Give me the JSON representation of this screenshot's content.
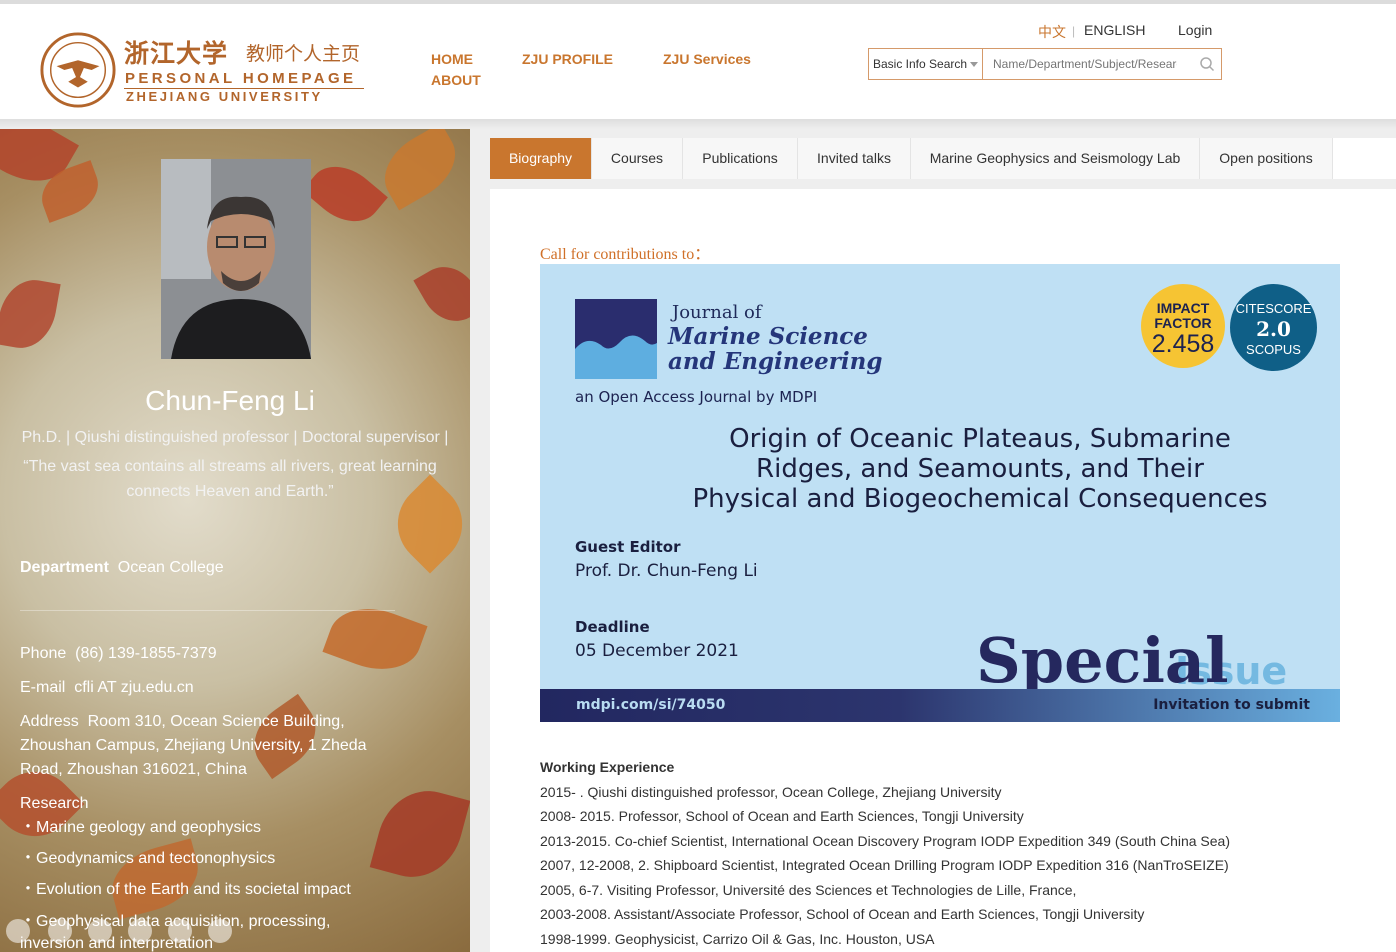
{
  "header": {
    "logo_cn": "浙江大学",
    "logo_cn2": "教师个人主页",
    "logo_en1": "PERSONAL HOMEPAGE",
    "logo_en2": "ZHEJIANG UNIVERSITY",
    "nav": [
      "HOME",
      "ZJU PROFILE",
      "ZJU Services",
      "ABOUT"
    ],
    "lang_cn": "中文",
    "lang_sep": "|",
    "lang_en": "ENGLISH",
    "login": "Login",
    "search_type": "Basic Info Search",
    "search_placeholder": "Name/Department/Subject/Research"
  },
  "profile": {
    "name": "Chun-Feng Li",
    "titles": "Ph.D.  |  Qiushi distinguished professor  |  Doctoral supervisor  |",
    "quote": "“The vast sea contains all streams all rivers, great learning connects Heaven and Earth.”",
    "department_label": "Department",
    "department": "Ocean College",
    "phone_label": "Phone",
    "phone": "(86) 139-1855-7379",
    "email_label": "E-mail",
    "email": "cfli AT zju.edu.cn",
    "address_label": "Address",
    "address": "Room 310, Ocean Science Building, Zhoushan Campus, Zhejiang University, 1 Zheda Road, Zhoushan 316021, China",
    "research_label": "Research",
    "research": [
      "・Marine geology and geophysics",
      "・Geodynamics and tectonophysics",
      "・Evolution of the Earth and its societal impact",
      "・Geophysical data acquisition, processing, inversion and interpretation"
    ]
  },
  "tabs": [
    "Biography",
    "Courses",
    "Publications",
    "Invited talks",
    "Marine Geophysics and Seismology Lab",
    "Open positions"
  ],
  "call": "Call for contributions to：",
  "banner": {
    "journal_of": "Journal of",
    "journal_name1": "Marine Science",
    "journal_name2": "and Engineering",
    "open_access": "an Open Access Journal by MDPI",
    "if_label1": "IMPACT",
    "if_label2": "FACTOR",
    "if_value": "2.458",
    "cs_label": "CITESCORE",
    "cs_value": "2.0",
    "cs_source": "SCOPUS",
    "headline1": "Origin of Oceanic Plateaus, Submarine",
    "headline2": "Ridges, and Seamounts, and Their",
    "headline3": "Physical and Biogeochemical Consequences",
    "guest_label": "Guest Editor",
    "guest": "Prof. Dr. Chun-Feng Li",
    "deadline_label": "Deadline",
    "deadline": "05 December 2021",
    "special": "Special",
    "issue": "Issue",
    "url": "mdpi.com/si/74050",
    "submit": "Invitation to submit"
  },
  "experience": {
    "heading": "Working Experience",
    "items": [
      "2015- . Qiushi distinguished professor,  Ocean College, Zhejiang University",
      "2008- 2015. Professor, School of Ocean and Earth Sciences, Tongji University",
      "2013-2015. Co-chief Scientist, International Ocean Discovery Program IODP Expedition 349 (South China Sea)",
      "2007, 12-2008, 2. Shipboard Scientist, Integrated Ocean Drilling Program IODP Expedition 316 (NanTroSEIZE)",
      "2005, 6-7. Visiting Professor, Université des Sciences et Technologies de Lille, France,",
      "2003-2008. Assistant/Associate Professor, School of Ocean and Earth Sciences, Tongji University",
      "1998-1999. Geophysicist, Carrizo Oil & Gas, Inc. Houston, USA"
    ]
  },
  "colors": {
    "accent": "#c9762e",
    "brand": "#b2652b"
  }
}
